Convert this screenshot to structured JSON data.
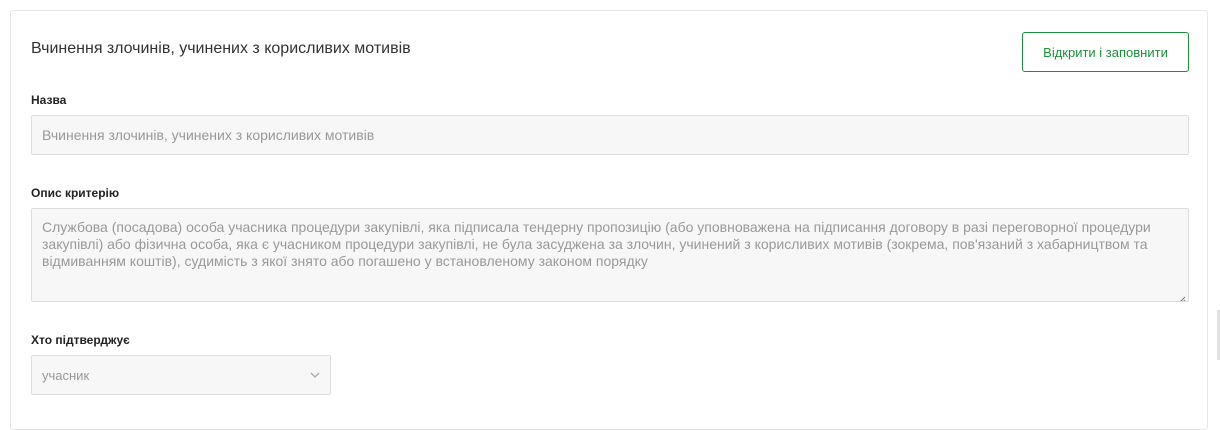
{
  "criterion": {
    "title": "Вчинення злочинів, учинених з корисливих мотивів",
    "open_button_label": "Відкрити і заповнити"
  },
  "fields": {
    "name": {
      "label": "Назва",
      "value": "Вчинення злочинів, учинених з корисливих мотивів"
    },
    "description": {
      "label": "Опис критерію",
      "value": "Службова (посадова) особа учасника процедури закупівлі, яка підписала тендерну пропозицію (або уповноважена на підписання договору в разі переговорної процедури закупівлі) або фізична особа, яка є учасником процедури закупівлі, не була засуджена за злочин, учинений з корисливих мотивів (зокрема, пов'язаний з хабарництвом та відмиванням коштів), судимість з якої знято або погашено у встановленому законом порядку"
    },
    "confirmed_by": {
      "label": "Хто підтверджує",
      "selected": "учасник"
    }
  },
  "colors": {
    "accent_green": "#1b8f3a",
    "field_bg": "#f7f7f7",
    "placeholder_text": "#999999"
  },
  "icons": {
    "select_chevron": "chevron-down-icon",
    "textarea_resize": "resize-handle-icon"
  }
}
